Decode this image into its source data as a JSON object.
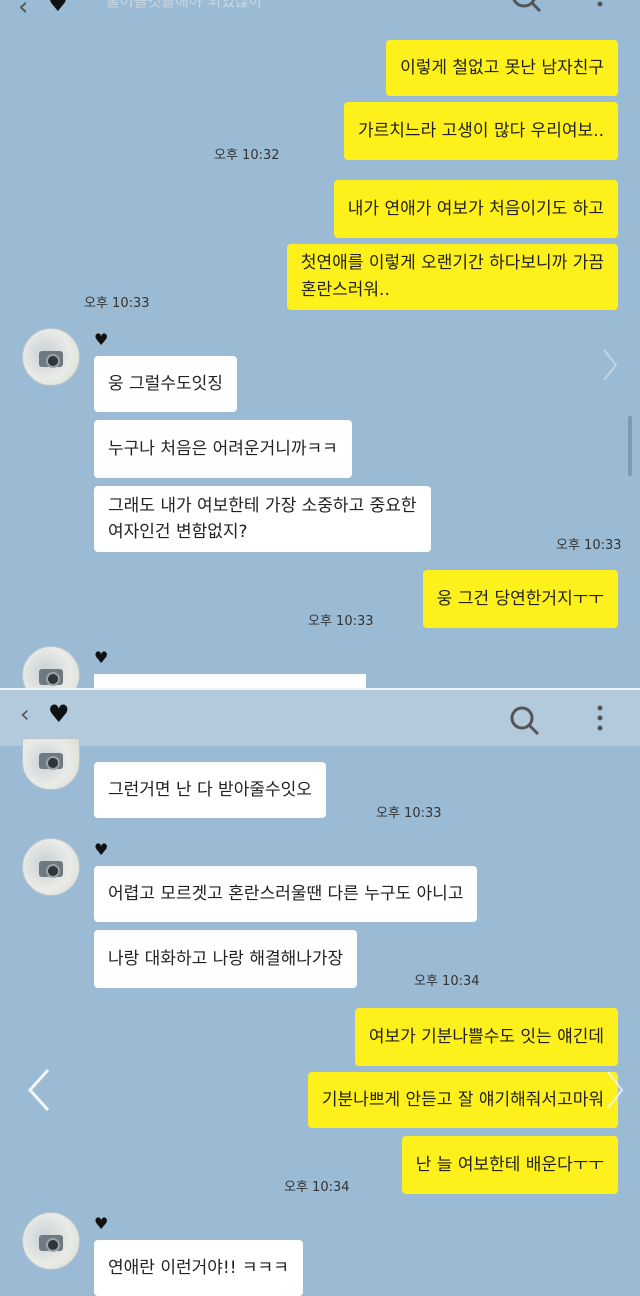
{
  "header1": {
    "heart": "♥",
    "faded_text": "물어볼것들해야 되었잖아"
  },
  "header2": {
    "heart": "♥"
  },
  "chat_a": {
    "m1": "이렇게 철없고 못난 남자친구",
    "m2": "가르치느라 고생이 많다 우리여보..",
    "t1": "오후 10:32",
    "m3": "내가 연애가 여보가 처음이기도 하고",
    "m4": "첫연애를 이렇게 오랜기간 하다보니까 가끔\n혼란스러워..",
    "t2": "오후 10:33",
    "sender_heart": "♥",
    "r1": "웅 그럴수도잇징",
    "r2": "누구나 처음은 어려운거니까ㅋㅋ",
    "r3": "그래도 내가 여보한테 가장 소중하고 중요한\n여자인건 변함없지?",
    "t3": "오후 10:33",
    "m5": "웅 그건 당연한거지ㅜㅜ",
    "t4": "오후 10:33",
    "sender_heart2": "♥"
  },
  "chat_b": {
    "r4": "그런거면 난 다 받아줄수잇오",
    "t5": "오후 10:33",
    "sender_heart": "♥",
    "r5": "어렵고 모르겟고 혼란스러울땐 다른 누구도 아니고",
    "r6": "나랑 대화하고 나랑 해결해나가장",
    "t6": "오후 10:34",
    "m6": "여보가 기분나쁠수도 잇는 얘긴데",
    "m7": "기분나쁘게 안듣고 잘 얘기해줘서고마워",
    "m8": "난 늘 여보한테 배운다ㅜㅜ",
    "t7": "오후 10:34",
    "sender_heart2": "♥",
    "r7": "연애란 이런거야!! ㅋㅋㅋ"
  }
}
